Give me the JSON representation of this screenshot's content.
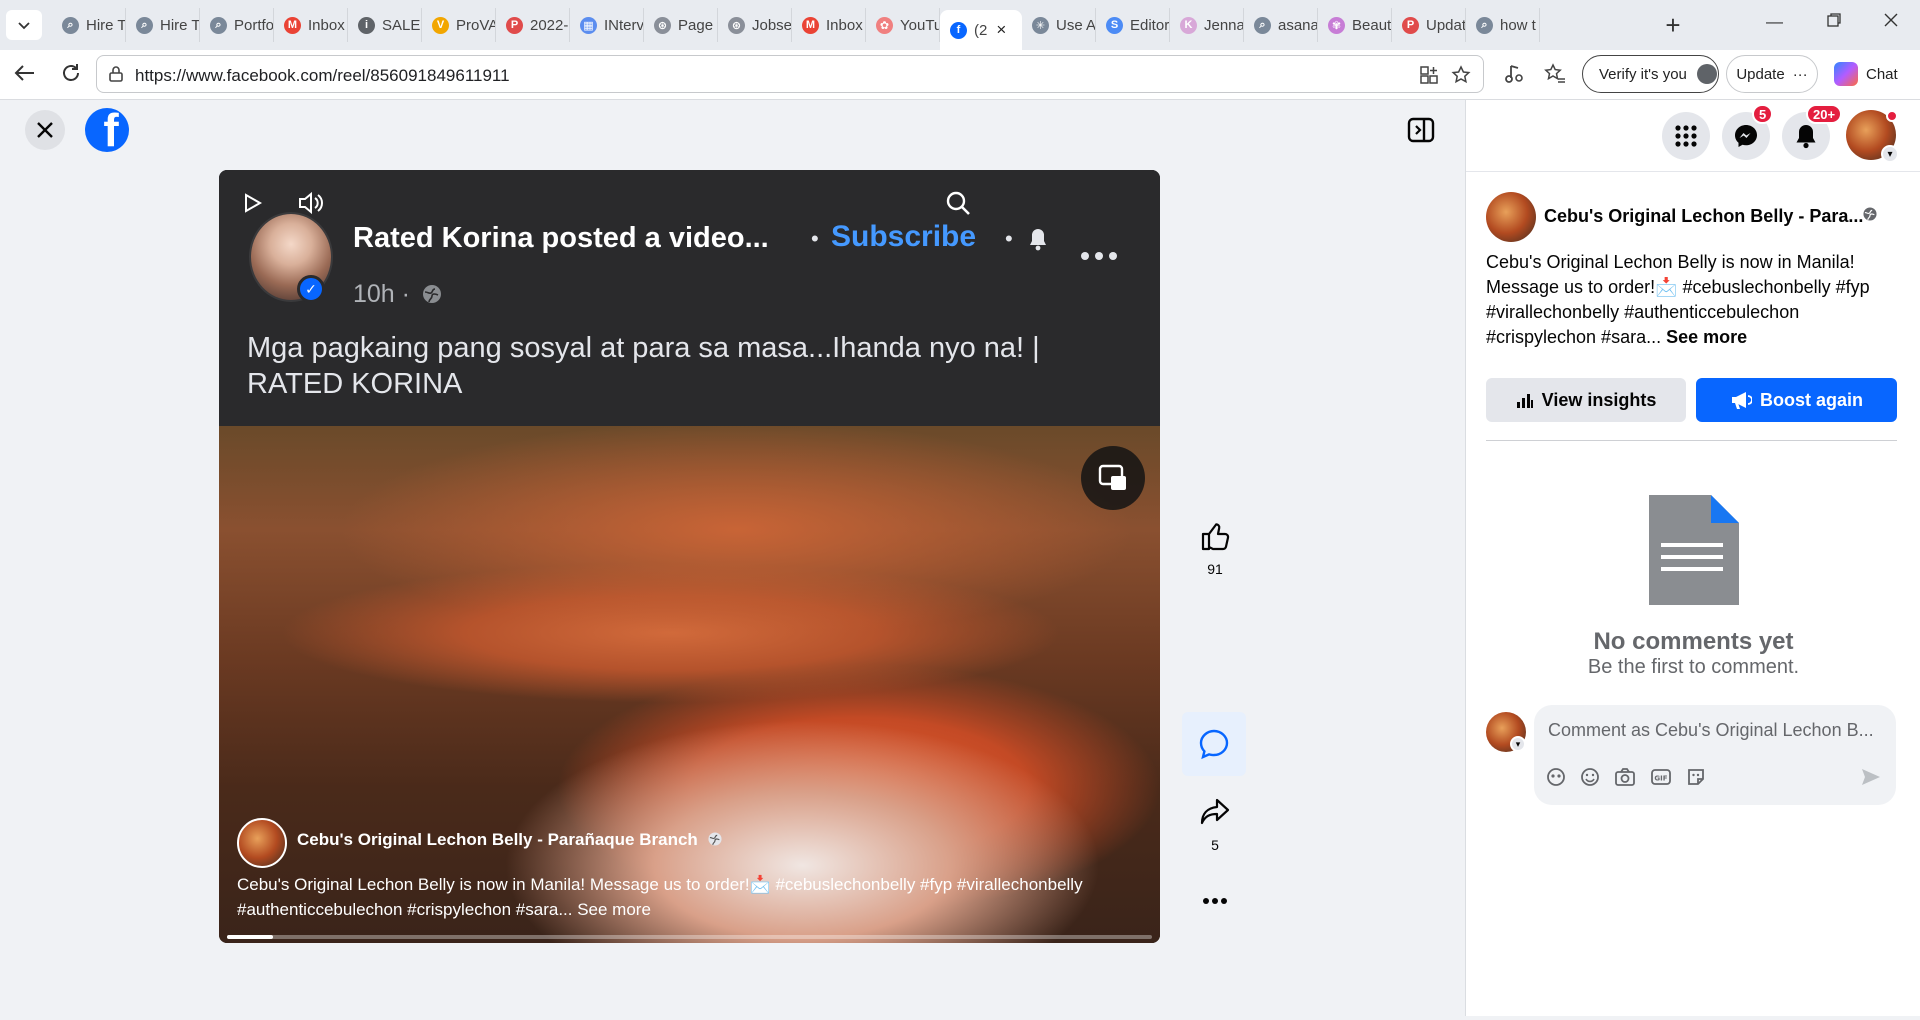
{
  "browser": {
    "tabs": [
      {
        "label": "Hire T",
        "color": "#7a8899",
        "glyph": "⌕"
      },
      {
        "label": "Hire T",
        "color": "#7a8899",
        "glyph": "⌕"
      },
      {
        "label": "Portfo",
        "color": "#7a8899",
        "glyph": "⌕"
      },
      {
        "label": "Inbox",
        "color": "#ea4335",
        "glyph": "M"
      },
      {
        "label": "SALES",
        "color": "#5f6368",
        "glyph": "i"
      },
      {
        "label": "ProVA",
        "color": "#f2a600",
        "glyph": "V"
      },
      {
        "label": "2022-",
        "color": "#e04b4b",
        "glyph": "P"
      },
      {
        "label": "INterv",
        "color": "#5b8def",
        "glyph": "▦"
      },
      {
        "label": "Page",
        "color": "#8a8f99",
        "glyph": "⊛"
      },
      {
        "label": "Jobse",
        "color": "#8a8f99",
        "glyph": "⊛"
      },
      {
        "label": "Inbox",
        "color": "#ea4335",
        "glyph": "M"
      },
      {
        "label": "YouTu",
        "color": "#f08080",
        "glyph": "✿"
      },
      {
        "label": "(2",
        "color": "#0866ff",
        "glyph": "f",
        "active": true
      },
      {
        "label": "Use A",
        "color": "#7a8899",
        "glyph": "✳"
      },
      {
        "label": "Editor",
        "color": "#4c8bf5",
        "glyph": "S"
      },
      {
        "label": "Jenna",
        "color": "#d8a8d8",
        "glyph": "K"
      },
      {
        "label": "asana",
        "color": "#7a8899",
        "glyph": "⌕"
      },
      {
        "label": "Beaut",
        "color": "#c77dd6",
        "glyph": "✾"
      },
      {
        "label": "Updat",
        "color": "#e04b4b",
        "glyph": "P"
      },
      {
        "label": "how t",
        "color": "#7a8899",
        "glyph": "⌕"
      }
    ],
    "url": "https://www.facebook.com/reel/856091849611911",
    "verify_label": "Verify it's you",
    "update_label": "Update",
    "chat_label": "Chat"
  },
  "video": {
    "poster": "Rated Korina posted a video...",
    "subscribe": "Subscribe",
    "time": "10h ·",
    "caption": "Mga pagkaing pang sosyal at para sa masa...Ihanda nyo na! | RATED KORINA",
    "page_name": "Cebu's Original Lechon Belly - Parañaque Branch",
    "description": "Cebu's Original Lechon Belly is now in Manila! Message us to order!📩 #cebuslechonbelly #fyp #virallechonbelly #authenticcebulechon #crispylechon #sara... See more",
    "progress": 0.05
  },
  "actions": {
    "likes": "91",
    "shares": "5"
  },
  "header": {
    "messenger_badge": "5",
    "notifications_badge": "20+"
  },
  "post": {
    "page_name": "Cebu's Original Lechon Belly - Para...",
    "text": "Cebu's Original Lechon Belly is now in Manila! Message us to order!📩 #cebuslechonbelly #fyp #virallechonbelly #authenticcebulechon #crispylechon #sara...",
    "see_more": "See more",
    "insights_label": "View insights",
    "boost_label": "Boost again"
  },
  "comments": {
    "empty_title": "No comments yet",
    "empty_subtitle": "Be the first to comment.",
    "placeholder": "Comment as Cebu's Original Lechon B..."
  },
  "colors": {
    "brand_blue": "#0866ff",
    "badge_red": "#e41e3f",
    "subscribe_blue": "#4599ff"
  }
}
